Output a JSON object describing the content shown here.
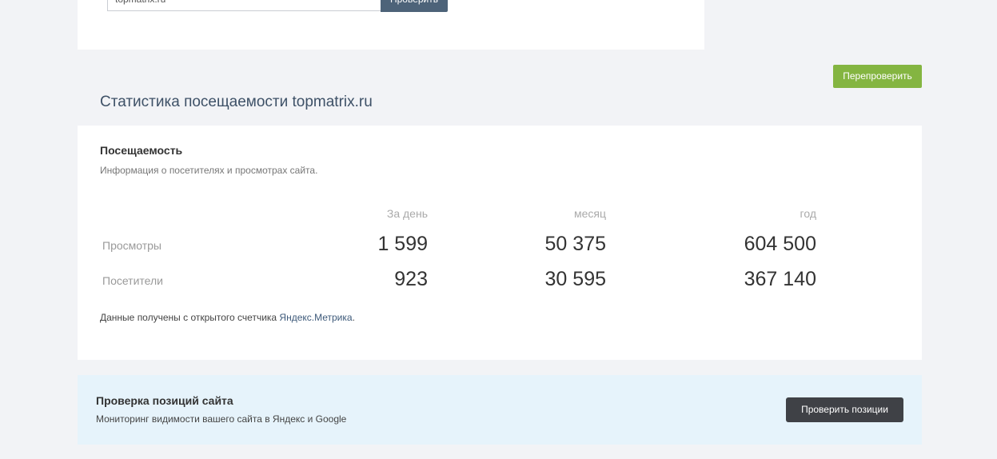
{
  "check_form": {
    "url_value": "topmatrix.ru",
    "submit_label": "Проверить"
  },
  "recheck_label": "Перепроверить",
  "stats_title": "Статистика посещаемости topmatrix.ru",
  "traffic": {
    "heading": "Посещаемость",
    "subtitle": "Информация о посетителях и просмотрах сайта.",
    "columns": [
      "За день",
      "месяц",
      "год"
    ],
    "rows": [
      {
        "label": "Просмотры",
        "values": [
          "1 599",
          "50 375",
          "604 500"
        ]
      },
      {
        "label": "Посетители",
        "values": [
          "923",
          "30 595",
          "367 140"
        ]
      }
    ],
    "source_prefix": "Данные получены с открытого счетчика ",
    "source_link": "Яндекс.Метрика",
    "source_suffix": "."
  },
  "positions": {
    "heading": "Проверка позиций сайта",
    "subtitle": "Мониторинг видимости вашего сайта в Яндекс и Google",
    "button_label": "Проверить позиции"
  },
  "colors": {
    "accent_green": "#84b541",
    "title_blue": "#3e5167",
    "positions_bg": "#e6f3fb",
    "dark_button": "#3f4146"
  }
}
